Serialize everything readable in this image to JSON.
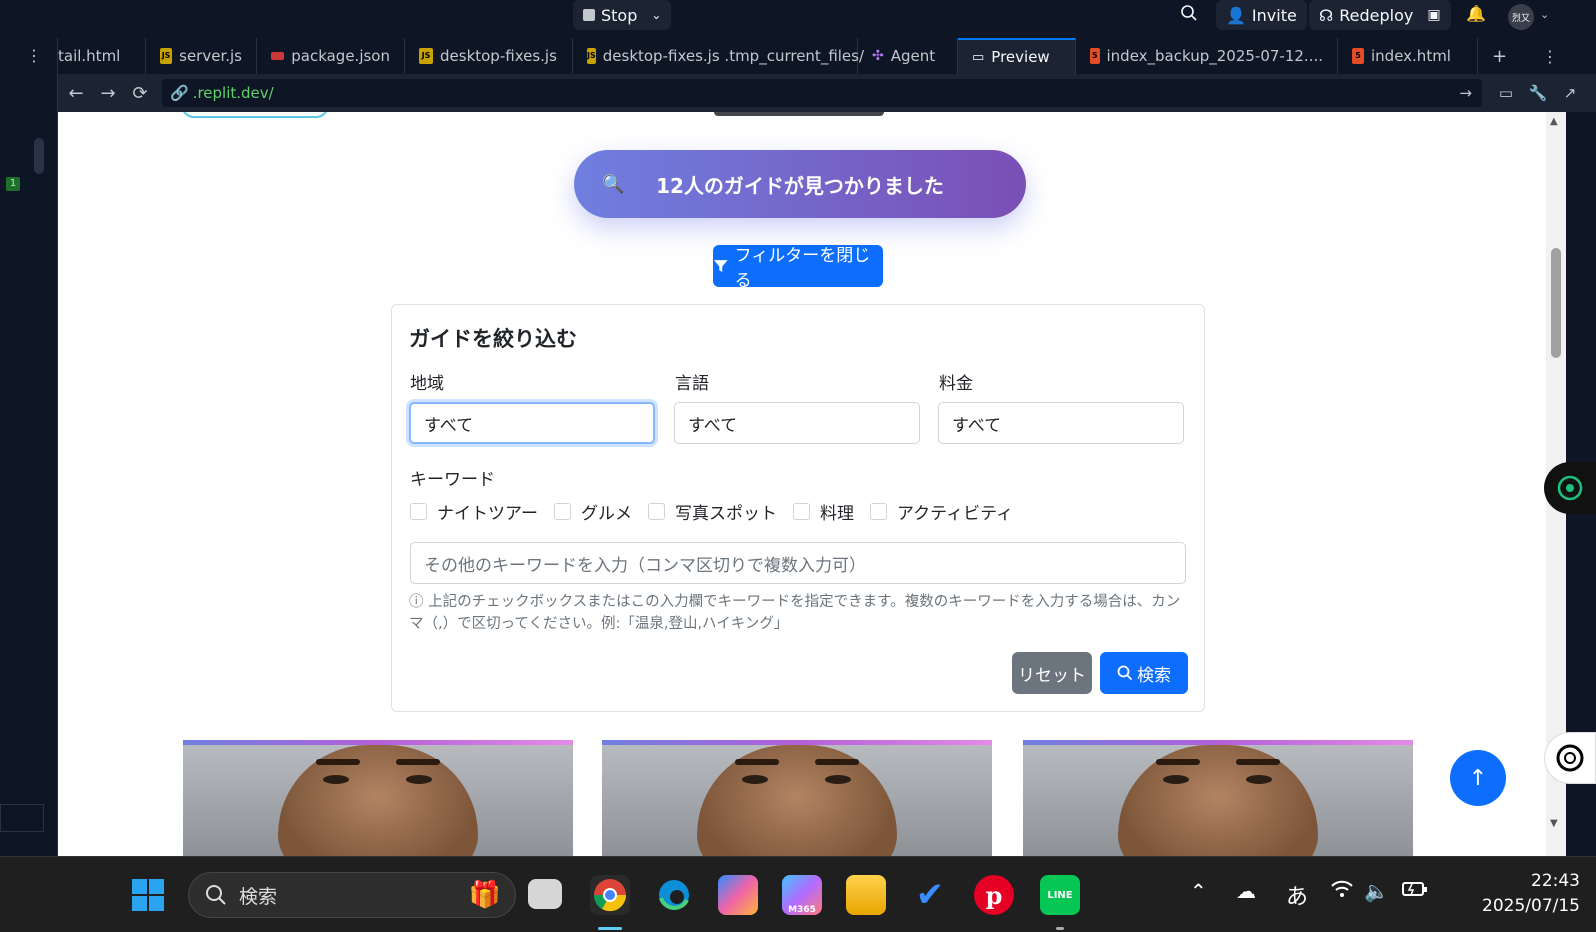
{
  "topbar": {
    "stop_label": "Stop",
    "invite_label": "Invite",
    "redeploy_label": "Redeploy",
    "avatar_text": "烈又"
  },
  "tabs": [
    {
      "label": "tail.html",
      "icon": "html-file-icon"
    },
    {
      "label": "server.js",
      "icon": "js-file-icon"
    },
    {
      "label": "package.json",
      "icon": "npm-file-icon"
    },
    {
      "label": "desktop-fixes.js",
      "icon": "js-file-icon"
    },
    {
      "label": "desktop-fixes.js .tmp_current_files/",
      "icon": "js-file-icon"
    },
    {
      "label": "Agent",
      "icon": "agent-icon"
    },
    {
      "label": "Preview",
      "icon": "preview-icon"
    },
    {
      "label": "index_backup_2025-07-12....",
      "icon": "html-file-icon"
    },
    {
      "label": "index.html",
      "icon": "html-file-icon"
    }
  ],
  "leftrail": {
    "badge": "1"
  },
  "urlbar": {
    "url": ".replit.dev/"
  },
  "page": {
    "found_text": "12人のガイドが見つかりました",
    "filter_toggle_label": "フィルターを閉じる",
    "filter_title": "ガイドを絞り込む",
    "region_label": "地域",
    "region_value": "すべて",
    "language_label": "言語",
    "language_value": "すべて",
    "price_label": "料金",
    "price_value": "すべて",
    "keyword_label": "キーワード",
    "keywords": [
      "ナイトツアー",
      "グルメ",
      "写真スポット",
      "料理",
      "アクティビティ"
    ],
    "keyword_placeholder": "その他のキーワードを入力（コンマ区切りで複数入力可）",
    "help_text": "上記のチェックボックスまたはこの入力欄でキーワードを指定できます。複数のキーワードを入力する場合は、カンマ（,）で区切ってください。例:「温泉,登山,ハイキング」",
    "reset_label": "リセット",
    "search_label": "検索"
  },
  "taskbar": {
    "search_placeholder": "検索",
    "ime": "あ",
    "time": "22:43",
    "date": "2025/07/15"
  },
  "colors": {
    "accent": "#0d6efd",
    "banner_start": "#6f7fe0",
    "banner_end": "#7b4fb5",
    "ide_bg": "#0e1525"
  }
}
